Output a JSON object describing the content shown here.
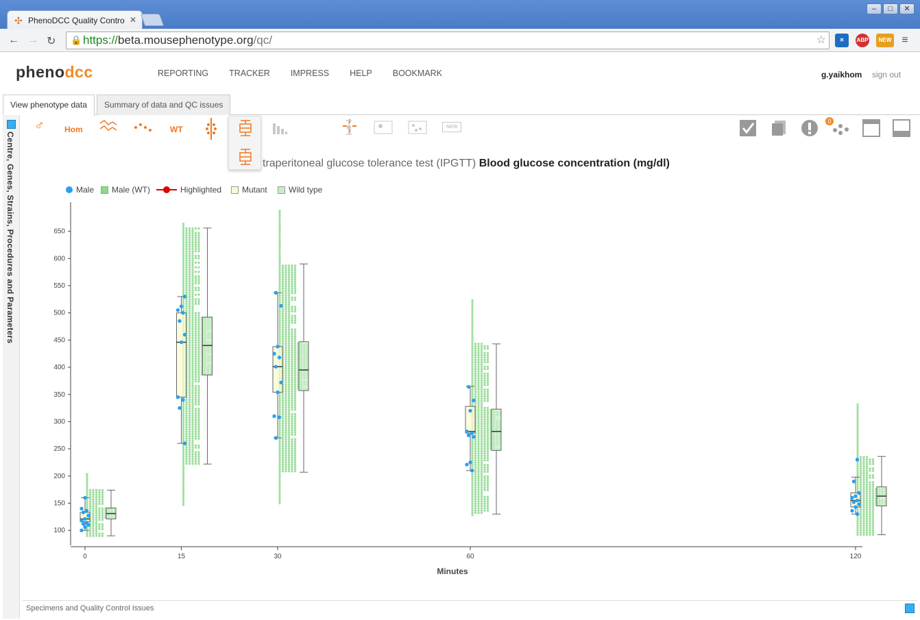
{
  "browser": {
    "tab_title": "PhenoDCC Quality Contro",
    "url_scheme": "https://",
    "url_host": "beta.mousephenotype.org",
    "url_path": "/qc/",
    "ext_abp": "ABP",
    "ext_new": "NEW"
  },
  "app": {
    "logo_pheno": "pheno",
    "logo_dcc": "dcc",
    "nav": [
      "REPORTING",
      "TRACKER",
      "IMPRESS",
      "HELP",
      "BOOKMARK"
    ],
    "user": "g.yaikhom",
    "signout": "sign out",
    "tabs": [
      "View phenotype data",
      "Summary of data and QC issues"
    ],
    "sidebar_label": "Centre, Genes, Strains, Procedures and Parameters",
    "toolbar": {
      "hom": "Hom",
      "wt": "WT",
      "new": "NEW",
      "issues_count": "0"
    },
    "title_prefix": "traperitoneal glucose tolerance test (IPGTT)",
    "title_param": "Blood glucose concentration (mg/dl)",
    "legend": [
      "Male",
      "Male (WT)",
      "Highlighted",
      "Mutant",
      "Wild type"
    ],
    "status_text": "Specimens and Quality Control Issues"
  },
  "colors": {
    "accent": "#f07822",
    "mutant_point": "#2a9ff0",
    "wt_point": "#8fd88f",
    "mutant_box": "#fafad2",
    "wt_box": "#c8edc8",
    "highlight": "#e00000"
  },
  "chart_data": {
    "type": "scatter",
    "xlabel": "Minutes",
    "ylabel": "",
    "x_ticks": [
      0,
      15,
      30,
      60,
      120
    ],
    "y_ticks": [
      100,
      150,
      200,
      250,
      300,
      350,
      400,
      450,
      500,
      550,
      600,
      650
    ],
    "ylim": [
      70,
      710
    ],
    "xlim": [
      0,
      120
    ],
    "grid": false,
    "series": [
      {
        "name": "Mutant",
        "boxes": [
          {
            "x": 0,
            "q1": 116,
            "median": 121,
            "q3": 133,
            "min": 100,
            "max": 160
          },
          {
            "x": 15,
            "q1": 345,
            "median": 446,
            "q3": 500,
            "min": 260,
            "max": 530
          },
          {
            "x": 30,
            "q1": 354,
            "median": 401,
            "q3": 438,
            "min": 270,
            "max": 537
          },
          {
            "x": 60,
            "q1": 279,
            "median": 282,
            "q3": 328,
            "min": 210,
            "max": 365
          },
          {
            "x": 120,
            "q1": 143,
            "median": 155,
            "q3": 169,
            "min": 130,
            "max": 198
          }
        ],
        "points": [
          [
            0,
            100
          ],
          [
            0,
            106
          ],
          [
            0,
            110
          ],
          [
            0,
            112
          ],
          [
            0,
            114
          ],
          [
            0,
            118
          ],
          [
            0,
            121
          ],
          [
            0,
            127
          ],
          [
            0,
            133
          ],
          [
            0,
            136
          ],
          [
            0,
            140
          ],
          [
            0,
            160
          ],
          [
            15,
            260
          ],
          [
            15,
            325
          ],
          [
            15,
            340
          ],
          [
            15,
            345
          ],
          [
            15,
            446
          ],
          [
            15,
            460
          ],
          [
            15,
            485
          ],
          [
            15,
            500
          ],
          [
            15,
            505
          ],
          [
            15,
            512
          ],
          [
            15,
            530
          ],
          [
            30,
            270
          ],
          [
            30,
            308
          ],
          [
            30,
            310
          ],
          [
            30,
            354
          ],
          [
            30,
            372
          ],
          [
            30,
            401
          ],
          [
            30,
            418
          ],
          [
            30,
            425
          ],
          [
            30,
            438
          ],
          [
            30,
            513
          ],
          [
            30,
            537
          ],
          [
            60,
            210
          ],
          [
            60,
            221
          ],
          [
            60,
            225
          ],
          [
            60,
            272
          ],
          [
            60,
            275
          ],
          [
            60,
            279
          ],
          [
            60,
            282
          ],
          [
            60,
            320
          ],
          [
            60,
            339
          ],
          [
            60,
            364
          ],
          [
            120,
            130
          ],
          [
            120,
            136
          ],
          [
            120,
            143
          ],
          [
            120,
            148
          ],
          [
            120,
            152
          ],
          [
            120,
            155
          ],
          [
            120,
            160
          ],
          [
            120,
            163
          ],
          [
            120,
            169
          ],
          [
            120,
            190
          ],
          [
            120,
            230
          ]
        ]
      },
      {
        "name": "Wild type",
        "boxes": [
          {
            "x": 0,
            "q1": 121,
            "median": 131,
            "q3": 141,
            "min": 90,
            "max": 174
          },
          {
            "x": 15,
            "q1": 386,
            "median": 440,
            "q3": 492,
            "min": 222,
            "max": 656
          },
          {
            "x": 30,
            "q1": 357,
            "median": 395,
            "q3": 447,
            "min": 207,
            "max": 590
          },
          {
            "x": 60,
            "q1": 247,
            "median": 282,
            "q3": 323,
            "min": 130,
            "max": 443
          },
          {
            "x": 120,
            "q1": 145,
            "median": 163,
            "q3": 180,
            "min": 92,
            "max": 236
          }
        ],
        "point_range": [
          {
            "x": 0,
            "min": 90,
            "max": 207
          },
          {
            "x": 15,
            "min": 147,
            "max": 665
          },
          {
            "x": 30,
            "min": 150,
            "max": 690
          },
          {
            "x": 60,
            "min": 128,
            "max": 525
          },
          {
            "x": 120,
            "min": 92,
            "max": 332
          }
        ]
      }
    ]
  }
}
